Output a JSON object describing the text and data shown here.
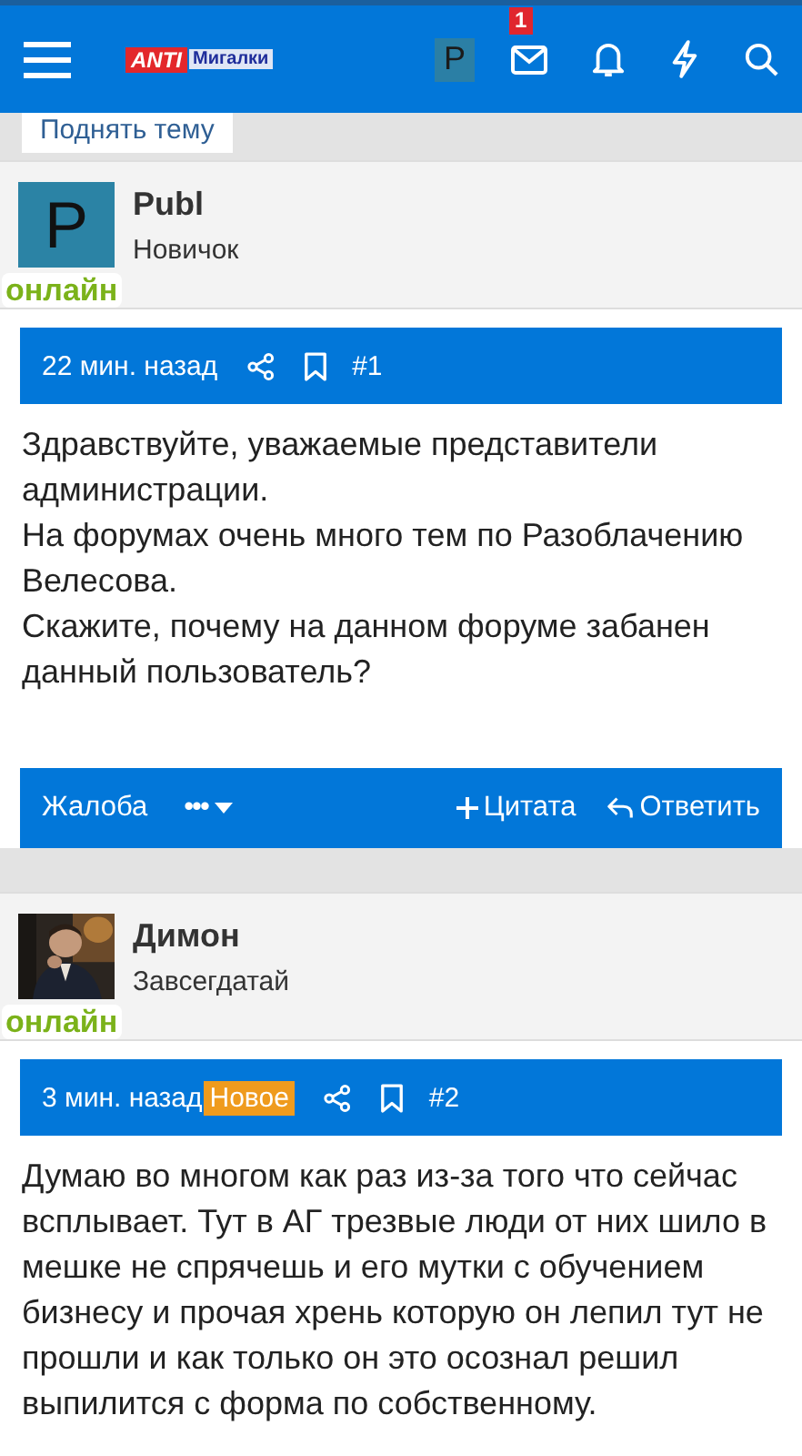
{
  "header": {
    "logo": {
      "mark": "ANTI",
      "name": "Мигалки"
    },
    "user_letter": "P",
    "inbox_count": "1"
  },
  "top_button": "Поднять тему",
  "posts": [
    {
      "author": "Publ",
      "rank": "Новичок",
      "status": "онлайн",
      "avatar": {
        "kind": "letter",
        "letter": "P"
      },
      "time": "22 мин. назад",
      "number": "#1",
      "paragraphs": [
        "Здравствуйте, уважаемые представители администрации.",
        "На форумах очень много тем по Разоблачению Велесова.",
        "Скажите, почему на данном форуме забанен данный пользователь?"
      ],
      "actions": {
        "report": "Жалоба",
        "more": "•••",
        "quote": "Цитата",
        "reply": "Ответить"
      }
    },
    {
      "author": "Димон",
      "rank": "Завсегдатай",
      "status": "онлайн",
      "avatar": {
        "kind": "picture"
      },
      "time": "3 мин. назад",
      "new_badge": "Новое",
      "number": "#2",
      "paragraphs": [
        "Думаю во многом как раз из-за того что сейчас всплывает. Тут в АГ трезвые люди от них шило в мешке не спрячешь и его мутки с обучением бизнесу и прочая хрень которую он лепил тут не прошли и как только он это осознал решил выпилится с форма по собственному."
      ]
    }
  ]
}
